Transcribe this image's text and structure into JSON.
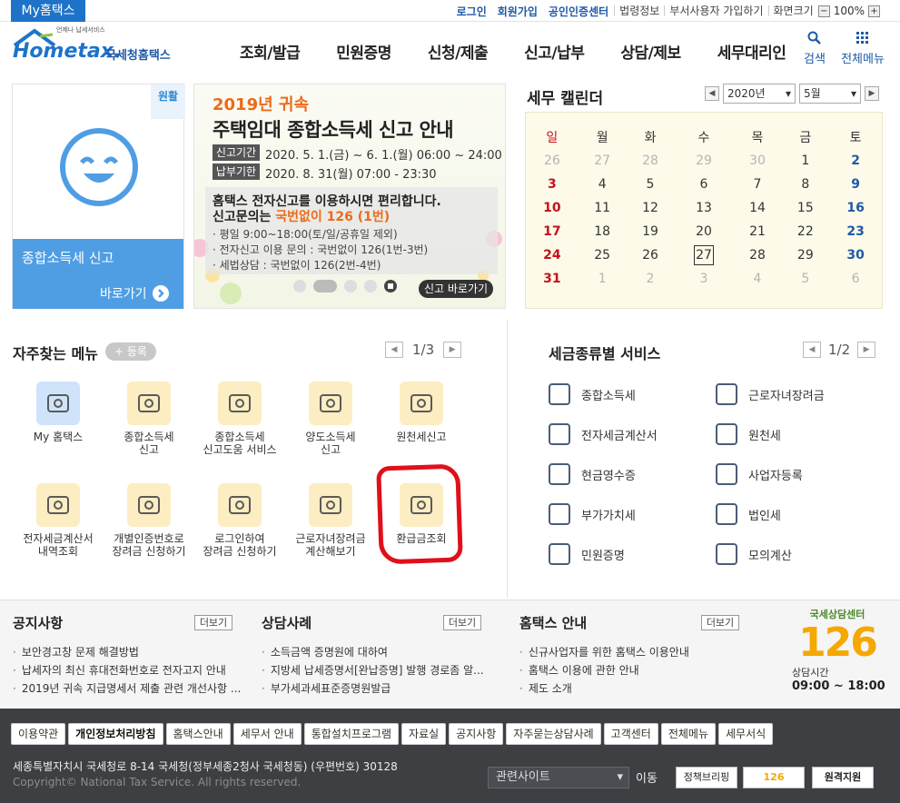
{
  "topbar": {
    "my_hometax": "My홈택스",
    "links": [
      "로그인",
      "회원가입",
      "공인인증센터"
    ],
    "gray_links": [
      "법령정보",
      "부서사용자 가입하기",
      "화면크기"
    ],
    "zoom_minus": "−",
    "zoom_value": "100%",
    "zoom_plus": "+"
  },
  "header": {
    "logo_tagline": "언제나 납세서비스",
    "logo_main": "Hometax.",
    "logo_sub": "국세청홈택스",
    "nav": [
      "조회/발급",
      "민원증명",
      "신청/제출",
      "신고/납부",
      "상담/제보",
      "세무대리인"
    ],
    "search_label": "검색",
    "all_menu_label": "전체메뉴"
  },
  "promo": {
    "badge": "원활",
    "title": "종합소득세 신고",
    "go": "바로가기"
  },
  "banner": {
    "year": "2019년 귀속",
    "title": "주택임대 종합소득세 신고 안내",
    "tag1": "신고기간",
    "val1": "2020. 5. 1.(금) ~ 6. 1.(월) 06:00 ~ 24:00",
    "tag2": "납부기한",
    "val2": "2020. 8. 31(월) 07:00 - 23:30",
    "line1": "홈택스 전자신고를 이용하시면 편리합니다.",
    "line2a": "신고문의는 ",
    "line2b": "국번없이 126 (1번)",
    "bullets": [
      "· 평일 9:00~18:00(토/일/공휴일 제외)",
      "· 전자신고 이용 문의 : 국번없이 126(1번-3번)",
      "· 세법상담 : 국번없이 126(2번-4번)"
    ],
    "go": "신고 바로가기"
  },
  "calendar": {
    "title": "세무 캘린더",
    "year": "2020년",
    "month": "5월",
    "weekdays": [
      "일",
      "월",
      "화",
      "수",
      "목",
      "금",
      "토"
    ],
    "weeks": [
      [
        "26",
        "27",
        "28",
        "29",
        "30",
        "1",
        "2"
      ],
      [
        "3",
        "4",
        "5",
        "6",
        "7",
        "8",
        "9"
      ],
      [
        "10",
        "11",
        "12",
        "13",
        "14",
        "15",
        "16"
      ],
      [
        "17",
        "18",
        "19",
        "20",
        "21",
        "22",
        "23"
      ],
      [
        "24",
        "25",
        "26",
        "27",
        "28",
        "29",
        "30"
      ],
      [
        "31",
        "1",
        "2",
        "3",
        "4",
        "5",
        "6"
      ]
    ],
    "today": "27"
  },
  "frequent": {
    "title": "자주찾는 메뉴",
    "add": "+ 등록",
    "page": "1/3",
    "items": [
      {
        "label": "My 홈택스",
        "icon": "user-icon"
      },
      {
        "label": "종합소득세\n신고",
        "icon": "calendar-icon"
      },
      {
        "label": "종합소득세\n신고도움 서비스",
        "icon": "document-search-icon"
      },
      {
        "label": "양도소득세\n신고",
        "icon": "house-icon"
      },
      {
        "label": "원천세신고",
        "icon": "calendar-icon"
      },
      {
        "label": "전자세금계산서\n내역조회",
        "icon": "invoice-search-icon"
      },
      {
        "label": "개별인증번호로\n장려금 신청하기",
        "icon": "heart-hand-icon"
      },
      {
        "label": "로그인하여\n장려금 신청하기",
        "icon": "heart-pen-icon"
      },
      {
        "label": "근로자녀장려금\n계산해보기",
        "icon": "calculator-heart-icon"
      },
      {
        "label": "환급금조회",
        "icon": "refund-icon"
      }
    ]
  },
  "tax_services": {
    "title": "세금종류별 서비스",
    "page": "1/2",
    "items": [
      "종합소득세",
      "근로자녀장려금",
      "전자세금계산서",
      "원천세",
      "현금영수증",
      "사업자등록",
      "부가가치세",
      "법인세",
      "민원증명",
      "모의계산"
    ]
  },
  "notice": {
    "sections": [
      {
        "title": "공지사항",
        "more": "더보기",
        "items": [
          "보안경고창 문제 해결방법",
          "납세자의 최신 휴대전화번호로 전자고지 안내",
          "2019년 귀속 지급명세서 제출 관련 개선사항 ..."
        ]
      },
      {
        "title": "상담사례",
        "more": "더보기",
        "items": [
          "소득금액 증명원에 대하여",
          "지방세 납세증명서[완납증명] 발행 경로좀 알...",
          "부가세과세표준증명원발급"
        ]
      },
      {
        "title": "홈택스 안내",
        "more": "더보기",
        "items": [
          "신규사업자를 위한 홈택스 이용안내",
          "홈택스 이용에 관한 안내",
          "제도 소개"
        ]
      }
    ],
    "center": {
      "title": "국세상담센터",
      "number": "126",
      "hours_label": "상담시간",
      "hours": "09:00 ~ 18:00"
    }
  },
  "footer": {
    "links": [
      "이용약관",
      "개인정보처리방침",
      "홈택스안내",
      "세무서 안내",
      "통합설치프로그램",
      "자료실",
      "공지사항",
      "자주묻는상담사례",
      "고객센터",
      "전체메뉴",
      "세무서식"
    ],
    "address": "세종특별자치시 국세청로 8-14 국세청(정부세종2청사 국세청동) (우편번호) 30128",
    "copyright": "Copyright© National Tax Service. All rights reserved.",
    "related": "관련사이트",
    "go": "이동",
    "badge1": "정책브리핑",
    "badge2": "126",
    "badge3": "원격지원"
  },
  "colors": {
    "brand_blue": "#1e73c9",
    "accent_orange": "#ec6a1a",
    "highlight_red": "#e0101a",
    "footer_bg": "#3d3f43"
  }
}
